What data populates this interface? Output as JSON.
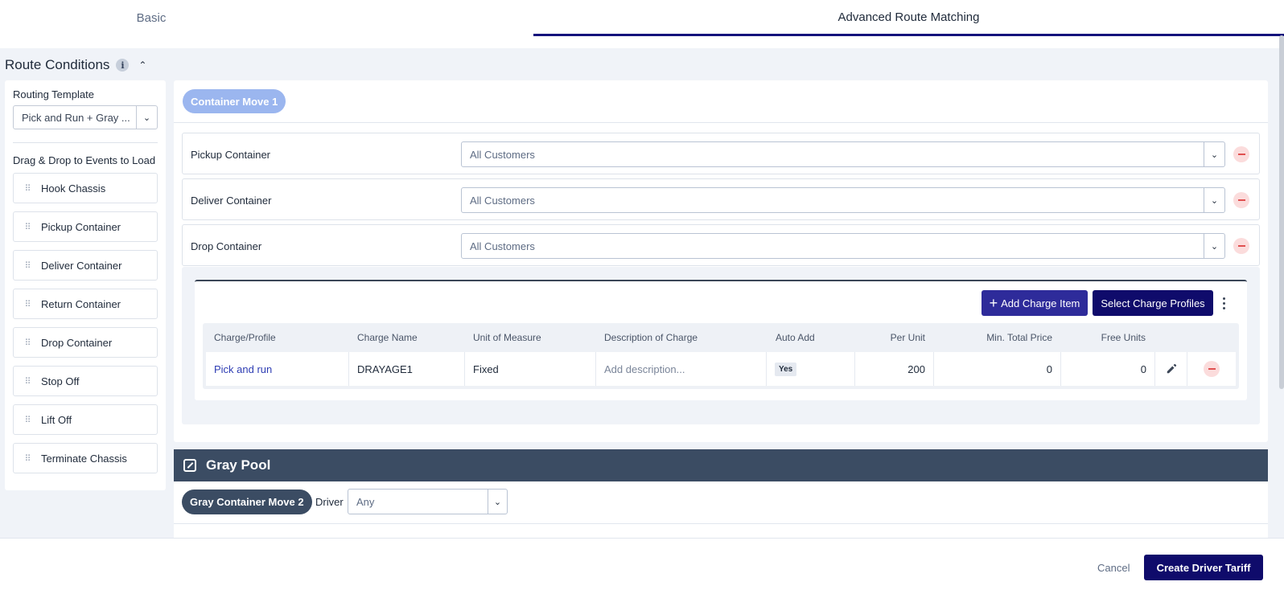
{
  "tabs": [
    {
      "label": "Basic",
      "active": false
    },
    {
      "label": "Advanced Route Matching",
      "active": true
    }
  ],
  "route_conditions": {
    "title": "Route Conditions",
    "info_icon": "i"
  },
  "left_panel": {
    "routing_template_label": "Routing Template",
    "routing_template_value": "Pick and Run + Gray ...",
    "drag_label": "Drag & Drop to Events to Load",
    "items": [
      {
        "label": "Hook Chassis"
      },
      {
        "label": "Pickup Container"
      },
      {
        "label": "Deliver Container"
      },
      {
        "label": "Return Container"
      },
      {
        "label": "Drop Container"
      },
      {
        "label": "Stop Off"
      },
      {
        "label": "Lift Off"
      },
      {
        "label": "Terminate Chassis"
      }
    ]
  },
  "container_move": {
    "pill": "Container Move 1",
    "events": [
      {
        "name": "Pickup Container",
        "customer": "All Customers"
      },
      {
        "name": "Deliver Container",
        "customer": "All Customers"
      },
      {
        "name": "Drop Container",
        "customer": "All Customers"
      }
    ]
  },
  "charges": {
    "add_button": "Add Charge Item",
    "profiles_button": "Select Charge Profiles",
    "columns": [
      "Charge/Profile",
      "Charge Name",
      "Unit of Measure",
      "Description of Charge",
      "Auto Add",
      "Per Unit",
      "Min. Total Price",
      "Free Units"
    ],
    "rows": [
      {
        "profile": "Pick and run",
        "charge_name": "DRAYAGE1",
        "unit": "Fixed",
        "description_placeholder": "Add description...",
        "auto_add": "Yes",
        "per_unit": "200",
        "min_total": "0",
        "free_units": "0"
      }
    ]
  },
  "gray_pool": {
    "title": "Gray Pool",
    "pill": "Gray Container Move 2",
    "driver_label": "Driver",
    "driver_value": "Any"
  },
  "footer": {
    "cancel": "Cancel",
    "create": "Create Driver Tariff"
  },
  "colors": {
    "primary": "#0f0b6b",
    "add_button": "#2e2b9a",
    "pill_light": "#9bb6ef",
    "gray_pool_header": "#3b4c63",
    "remove": "#e05050"
  }
}
